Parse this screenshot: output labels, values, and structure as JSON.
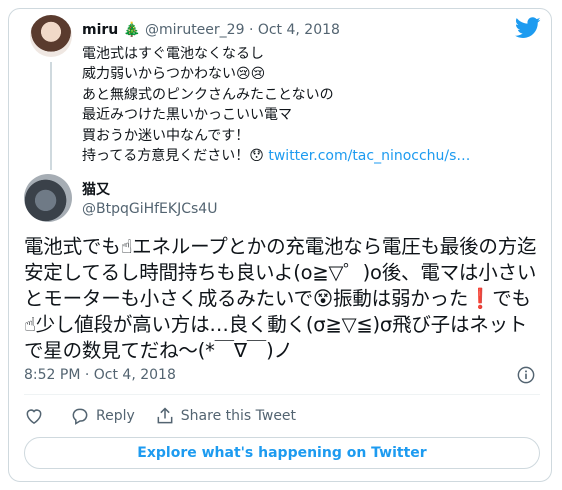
{
  "quoted": {
    "name": "miru 🎄",
    "handle": "@miruteer_29",
    "date": "Oct 4, 2018",
    "lines": [
      "電池式はすぐ電池なくなるし",
      "威力弱いからつかわない😢😢",
      "あと無線式のピンクさんみたことないの",
      "最近みつけた黒いかっこいい電マ",
      "買おうか迷い中なんです！"
    ],
    "last_line": "持ってる方意見ください！😯 ",
    "link": "twitter.com/tac_ninocchu/s…"
  },
  "main": {
    "name": "猫又",
    "handle": "@BtpqGiHfEKJCs4U",
    "text": "電池式でも☝エネループとかの充電池なら電圧も最後の方迄安定してるし時間持ちも良いよ(o≧▽゜)o後、電マは小さいとモーターも小さく成るみたいで😵振動は弱かった❗でも☝少し値段が高い方は…良く動く(σ≧▽≦)σ飛び子はネットで星の数見てだね～(*￣∇￣)ノ",
    "timestamp": "8:52 PM · Oct 4, 2018"
  },
  "actions": {
    "reply_label": "Reply",
    "share_label": "Share this Tweet"
  },
  "explore_label": "Explore what's happening on Twitter",
  "colors": {
    "accent": "#1d9bf0",
    "text": "#0f1419",
    "muted": "#536471",
    "border": "#cfd9de"
  }
}
